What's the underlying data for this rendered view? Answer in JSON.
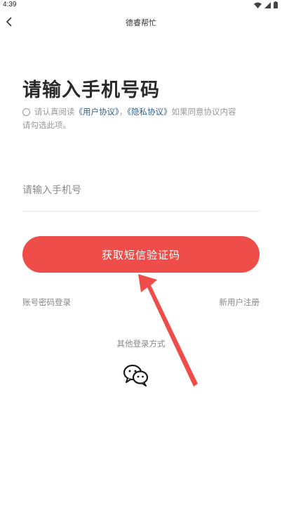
{
  "status_bar": {
    "time": "4:39"
  },
  "nav": {
    "title": "德睿帮忙"
  },
  "page": {
    "title": "请输入手机号码"
  },
  "agreement": {
    "prefix": "请认真阅读",
    "user_agreement": "《用户协议》",
    "separator": "，",
    "privacy_policy": "《隐私协议》",
    "suffix_line1": "如果同意协议内容",
    "line2": "请勾选此项。"
  },
  "phone": {
    "placeholder": "请输入手机号",
    "value": ""
  },
  "sms_button": {
    "label": "获取短信验证码"
  },
  "links": {
    "password_login": "账号密码登录",
    "register": "新用户注册"
  },
  "other_login": {
    "label": "其他登录方式"
  },
  "colors": {
    "accent": "#ef4d4a",
    "link": "#2f5d8a",
    "annotation": "#ef4d4a"
  }
}
